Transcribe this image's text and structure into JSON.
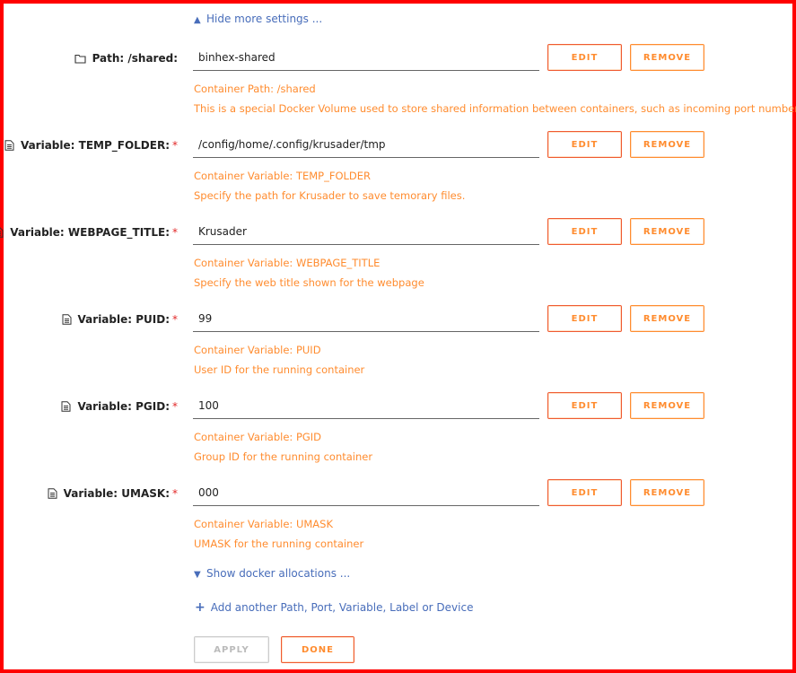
{
  "hide_settings_label": "Hide more settings ...",
  "show_docker_label": "Show docker allocations ...",
  "add_link_label": "Add another Path, Port, Variable, Label or Device",
  "apply_label": "APPLY",
  "done_label": "DONE",
  "colors": {
    "accent_orange": "#ff8c2f",
    "link_blue": "#486dba",
    "required_red": "#e22828",
    "border_red": "#ff0000"
  },
  "rows": [
    {
      "label": "Path: /shared:",
      "icon": "folder-icon",
      "required": false,
      "value": "binhex-shared",
      "desc1": "Container Path: /shared",
      "desc2": "This is a special Docker Volume used to store shared information between containers, such as incoming port number.",
      "edit_label": "EDIT",
      "remove_label": "REMOVE"
    },
    {
      "label": "Variable: TEMP_FOLDER:",
      "icon": "document-icon",
      "required": true,
      "required_mark": "*",
      "value": "/config/home/.config/krusader/tmp",
      "desc1": "Container Variable: TEMP_FOLDER",
      "desc2": "Specify the path for Krusader to save temorary files.",
      "edit_label": "EDIT",
      "remove_label": "REMOVE"
    },
    {
      "label": "Variable: WEBPAGE_TITLE:",
      "icon": "document-icon",
      "required": true,
      "required_mark": "*",
      "value": "Krusader",
      "desc1": "Container Variable: WEBPAGE_TITLE",
      "desc2": "Specify the web title shown for the webpage",
      "edit_label": "EDIT",
      "remove_label": "REMOVE"
    },
    {
      "label": "Variable: PUID:",
      "icon": "document-icon",
      "required": true,
      "required_mark": "*",
      "value": "99",
      "desc1": "Container Variable: PUID",
      "desc2": "User ID for the running container",
      "edit_label": "EDIT",
      "remove_label": "REMOVE"
    },
    {
      "label": "Variable: PGID:",
      "icon": "document-icon",
      "required": true,
      "required_mark": "*",
      "value": "100",
      "desc1": "Container Variable: PGID",
      "desc2": "Group ID for the running container",
      "edit_label": "EDIT",
      "remove_label": "REMOVE"
    },
    {
      "label": "Variable: UMASK:",
      "icon": "document-icon",
      "required": true,
      "required_mark": "*",
      "value": "000",
      "desc1": "Container Variable: UMASK",
      "desc2": "UMASK for the running container",
      "edit_label": "EDIT",
      "remove_label": "REMOVE"
    }
  ]
}
